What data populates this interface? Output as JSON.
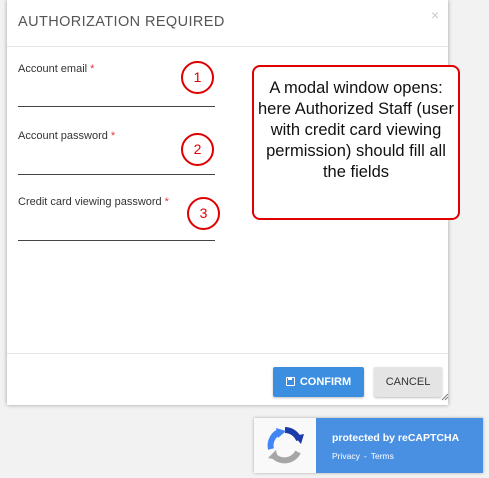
{
  "modal": {
    "title": "AUTHORIZATION REQUIRED",
    "close_glyph": "×"
  },
  "fields": [
    {
      "label": "Account email",
      "required_mark": "*",
      "step": "1",
      "value": ""
    },
    {
      "label": "Account password",
      "required_mark": "*",
      "step": "2",
      "value": ""
    },
    {
      "label": "Credit card viewing password",
      "required_mark": "*",
      "step": "3",
      "value": ""
    }
  ],
  "callout": {
    "text": "A modal window opens: here Authorized Staff (user with credit card viewing permission) should fill all the fields"
  },
  "buttons": {
    "confirm_label": "CONFIRM",
    "cancel_label": "CANCEL"
  },
  "recaptcha": {
    "protected_text": "protected by reCAPTCHA",
    "privacy_link": "Privacy",
    "terms_link": "Terms"
  },
  "colors": {
    "confirm_button": "#3c8fe0",
    "annotation_red": "#e00000",
    "recaptcha_blue": "#4a90e2",
    "required_star": "#e53935"
  }
}
